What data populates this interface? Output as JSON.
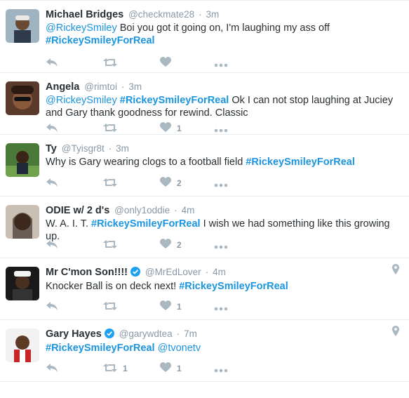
{
  "colors": {
    "link": "#1b95e0",
    "muted": "#8899a6",
    "icon": "#aab8c2",
    "verified": "#1da1f2"
  },
  "tweets": [
    {
      "name": "Michael Bridges",
      "handle": "@checkmate28",
      "separator": "·",
      "time": "3m",
      "text_parts": [
        {
          "type": "mention",
          "text": "@RickeySmiley"
        },
        {
          "type": "text",
          "text": " Boi you got it going on, I'm laughing my ass off"
        },
        {
          "type": "break"
        },
        {
          "type": "hashtag",
          "text": "#RickeySmileyForReal"
        }
      ],
      "likes": "",
      "retweets": "",
      "verified": false,
      "geo": false
    },
    {
      "name": "Angela",
      "handle": "@rimtoi",
      "separator": "·",
      "time": "3m",
      "text_parts": [
        {
          "type": "mention",
          "text": "@RickeySmiley"
        },
        {
          "type": "text",
          "text": " "
        },
        {
          "type": "hashtag",
          "text": "#RickeySmileyForReal"
        },
        {
          "type": "text",
          "text": " Ok I can not stop laughing at Juciey and Gary thank goodness for rewind. Classic"
        }
      ],
      "likes": "1",
      "retweets": "",
      "verified": false,
      "geo": false
    },
    {
      "name": "Ty",
      "handle": "@Tyisgr8t",
      "separator": "·",
      "time": "3m",
      "text_parts": [
        {
          "type": "text",
          "text": "Why is Gary wearing clogs to a football field "
        },
        {
          "type": "hashtag",
          "text": "#RickeySmileyForReal"
        }
      ],
      "likes": "2",
      "retweets": "",
      "verified": false,
      "geo": false
    },
    {
      "name": "ODIE w/ 2 d's",
      "handle": "@only1oddie",
      "separator": "·",
      "time": "4m",
      "text_parts": [
        {
          "type": "text",
          "text": "W. A. I. T. "
        },
        {
          "type": "hashtag",
          "text": "#RickeySmileyForReal"
        },
        {
          "type": "text",
          "text": " I wish we had something like this growing up."
        }
      ],
      "likes": "2",
      "retweets": "",
      "verified": false,
      "geo": false
    },
    {
      "name": "Mr C'mon Son!!!!",
      "handle": "@MrEdLover",
      "separator": "·",
      "time": "4m",
      "text_parts": [
        {
          "type": "text",
          "text": "Knocker Ball is on deck next!  "
        },
        {
          "type": "hashtag",
          "text": "#RickeySmileyForReal"
        }
      ],
      "likes": "1",
      "retweets": "",
      "verified": true,
      "geo": true
    },
    {
      "name": "Gary Hayes",
      "handle": "@garywdtea",
      "separator": "·",
      "time": "7m",
      "text_parts": [
        {
          "type": "hashtag",
          "text": "#RickeySmileyForReal"
        },
        {
          "type": "text",
          "text": " "
        },
        {
          "type": "mention",
          "text": "@tvonetv"
        }
      ],
      "likes": "1",
      "retweets": "1",
      "verified": true,
      "geo": true
    }
  ]
}
